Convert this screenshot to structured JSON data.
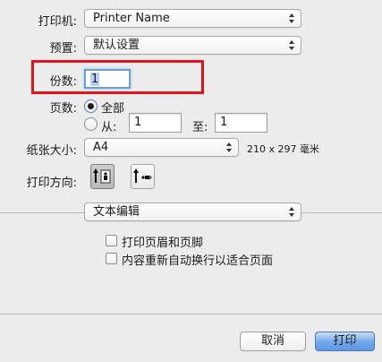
{
  "printer": {
    "label": "打印机:",
    "value": "Printer Name"
  },
  "presets": {
    "label": "预置:",
    "value": "默认设置"
  },
  "copies": {
    "label": "份数:",
    "value": "1"
  },
  "pages": {
    "label": "页数:",
    "all_label": "全部",
    "from_label": "从:",
    "from_value": "1",
    "to_label": "至:",
    "to_value": "1"
  },
  "paper": {
    "label": "纸张大小:",
    "value": "A4",
    "dimensions": "210 x 297 毫米"
  },
  "orientation": {
    "label": "打印方向:",
    "selected": "portrait"
  },
  "section": {
    "value": "文本编辑"
  },
  "options": [
    {
      "label": "打印页眉和页脚",
      "checked": false
    },
    {
      "label": "内容重新自动换行以适合页面",
      "checked": false
    }
  ],
  "buttons": {
    "cancel": "取消",
    "print": "打印"
  },
  "colors": {
    "highlight_box": "#e0141a",
    "primary_button": "#6fa6ea"
  }
}
